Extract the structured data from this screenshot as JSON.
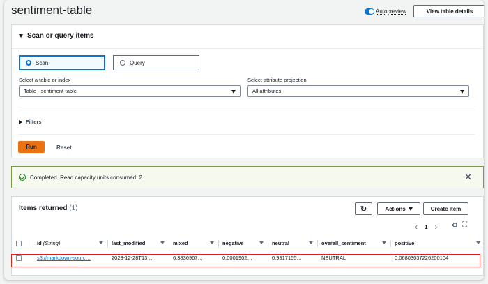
{
  "page": {
    "title": "sentiment-table",
    "autopreview_label": "Autopreview",
    "view_details_label": "View table details"
  },
  "scan_panel": {
    "header": "Scan or query items",
    "scan_label": "Scan",
    "query_label": "Query",
    "selected_mode": "Scan",
    "table_label": "Select a table or index",
    "table_value": "Table - sentiment-table",
    "projection_label": "Select attribute projection",
    "projection_value": "All attributes",
    "filters_label": "Filters",
    "run_label": "Run",
    "reset_label": "Reset"
  },
  "alert": {
    "message": "Completed. Read capacity units consumed: 2",
    "status_color": "#037f0c",
    "close_glyph": "✕"
  },
  "items": {
    "title": "Items returned",
    "count": "(1)",
    "refresh_glyph": "↻",
    "actions_label": "Actions",
    "create_label": "Create item",
    "pagination": {
      "prev": "‹",
      "page": "1",
      "next": "›"
    },
    "settings_glyph": "⚙",
    "fullscreen_glyph": "⛶",
    "columns": [
      {
        "name": "id",
        "type": "(String)"
      },
      {
        "name": "last_modified"
      },
      {
        "name": "mixed"
      },
      {
        "name": "negative"
      },
      {
        "name": "neutral"
      },
      {
        "name": "overall_sentiment"
      },
      {
        "name": "positive"
      }
    ],
    "rows": [
      {
        "id": "s3://markdown-sourc…",
        "last_modified": "2023-12-28T13:…",
        "mixed": "6.3836967…",
        "negative": "0.0001902…",
        "neutral": "0.9317155…",
        "overall_sentiment": "NEUTRAL",
        "positive": "0.06803037226200104"
      }
    ]
  }
}
